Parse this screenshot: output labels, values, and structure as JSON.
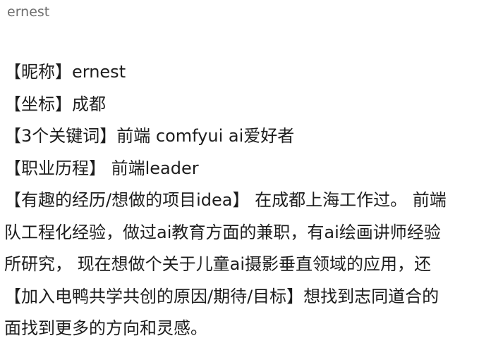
{
  "post": {
    "author": "ernest",
    "lines": [
      "【昵称】ernest",
      "【坐标】成都",
      "【3个关键词】前端 comfyui ai爱好者",
      "【职业历程】 前端leader",
      "【有趣的经历/想做的项目idea】 在成都上海工作过。 前端",
      "队工程化经验，做过ai教育方面的兼职，有ai绘画讲师经验",
      "所研究， 现在想做个关于儿童ai摄影垂直领域的应用，还",
      "【加入电鸭共学共创的原因/期待/目标】想找到志同道合的",
      "面找到更多的方向和灵感。"
    ]
  }
}
